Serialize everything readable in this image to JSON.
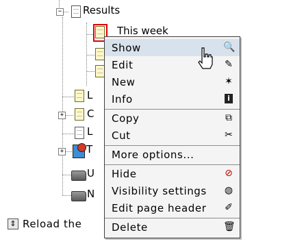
{
  "tree": {
    "root_label": "Results",
    "selected_label": "This week",
    "partial_labels": [
      "L",
      "C",
      "L",
      "T",
      "U",
      "N"
    ]
  },
  "footer": {
    "reload_label": "Reload the"
  },
  "context_menu": {
    "items": [
      {
        "label": "Show",
        "icon": "magnifier-icon"
      },
      {
        "label": "Edit",
        "icon": "edit-icon"
      },
      {
        "label": "New",
        "icon": "new-page-icon"
      },
      {
        "label": "Info",
        "icon": "info-icon"
      },
      {
        "label": "Copy",
        "icon": "copy-icon"
      },
      {
        "label": "Cut",
        "icon": "scissors-icon"
      },
      {
        "label": "More options...",
        "icon": ""
      },
      {
        "label": "Hide",
        "icon": "hide-icon"
      },
      {
        "label": "Visibility settings",
        "icon": "visibility-icon"
      },
      {
        "label": "Edit page header",
        "icon": "pen-icon"
      },
      {
        "label": "Delete",
        "icon": "trash-icon"
      }
    ],
    "highlighted_item": "Show"
  },
  "colors": {
    "menu_highlight": "#d8e2ec",
    "selection_border": "#e00000"
  }
}
